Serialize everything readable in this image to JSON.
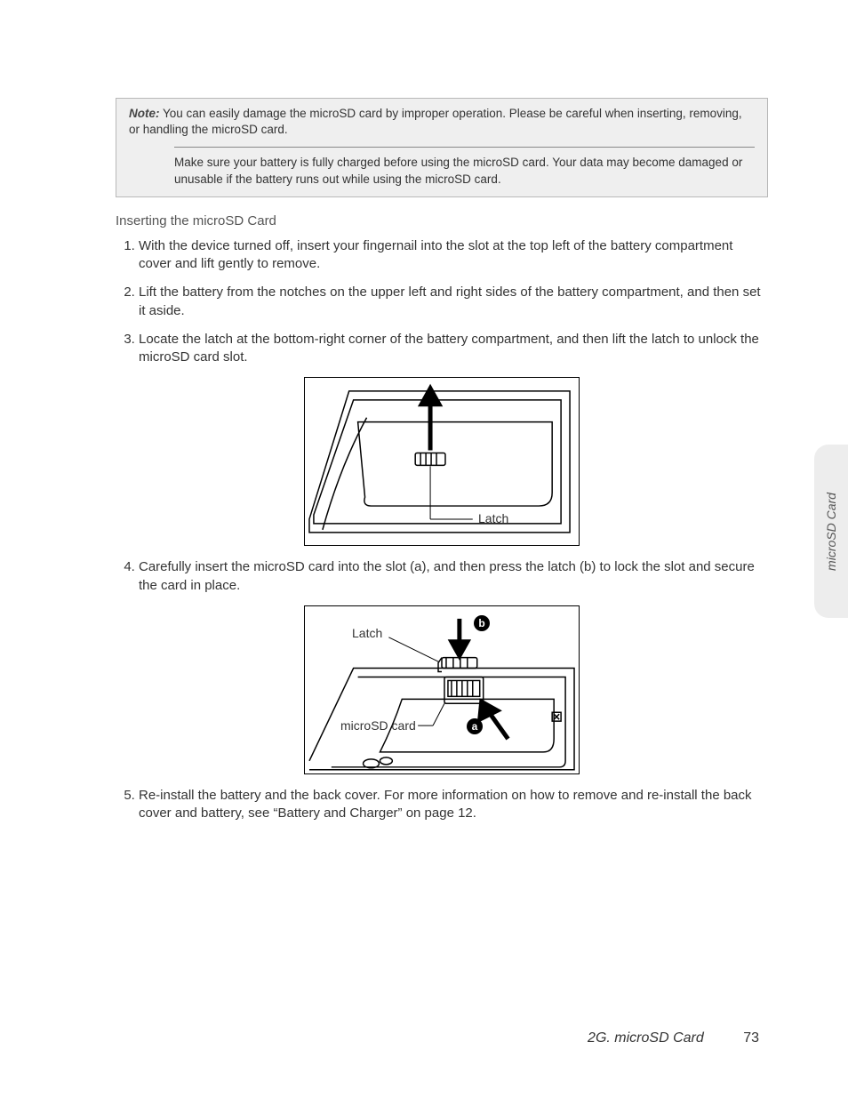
{
  "noteBox": {
    "label": "Note:",
    "line1": "You can easily damage the microSD card by improper operation. Please be careful when inserting, removing, or handling the microSD card.",
    "line2": "Make sure your battery is fully charged before using the microSD card. Your data may become damaged or unusable if the battery runs out while using the microSD card."
  },
  "heading": "Inserting the microSD Card",
  "steps": {
    "s1": "With the device turned off, insert your fingernail into the slot at the top left of the battery compartment cover and lift gently to remove.",
    "s2": "Lift the battery from the notches on the upper left and right sides of the battery compartment, and then set it aside.",
    "s3": "Locate the latch at the bottom-right corner of the battery compartment, and then lift the latch to unlock the microSD card slot.",
    "s4": "Carefully insert the microSD card into the slot (a), and then press the latch (b) to lock the slot and secure the card in place.",
    "s5": "Re-install the battery and the back cover. For more information on how to remove and re-install the back cover and battery, see “Battery and Charger” on page 12."
  },
  "fig1": {
    "latchLabel": "Latch"
  },
  "fig2": {
    "latchLabel": "Latch",
    "cardLabel": "microSD card",
    "markerA": "a",
    "markerB": "b"
  },
  "sideTab": "microSD Card",
  "footer": {
    "section": "2G. microSD Card",
    "page": "73"
  }
}
